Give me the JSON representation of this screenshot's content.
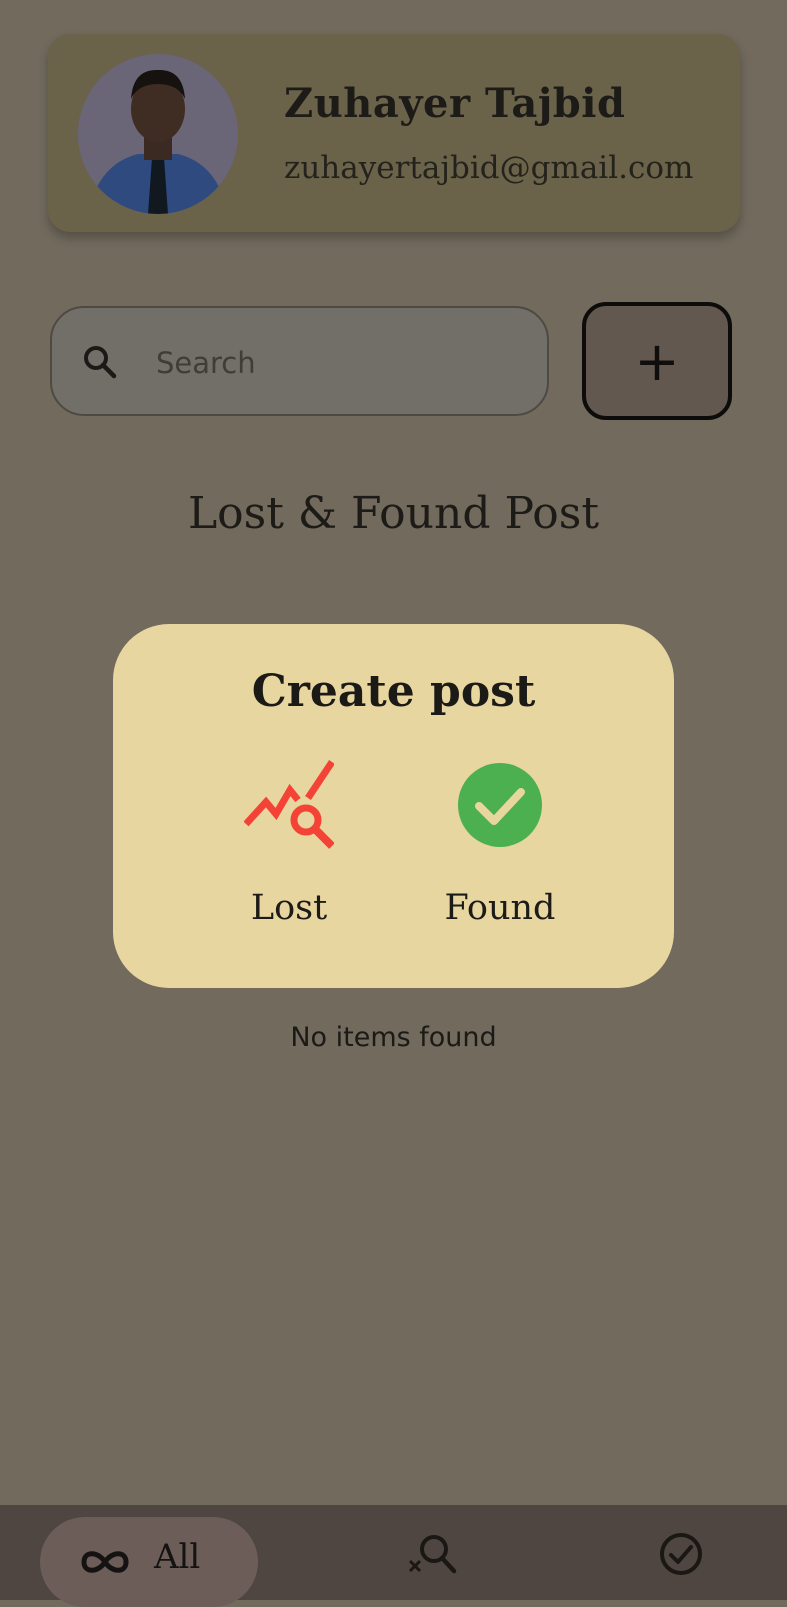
{
  "profile": {
    "name": "Zuhayer Tajbid",
    "email": "zuhayertajbid@gmail.com",
    "avatar_icon": "avatar-photo"
  },
  "search": {
    "placeholder": "Search",
    "value": "",
    "icon": "search-icon"
  },
  "add_button": {
    "label": "+",
    "icon": "plus-icon"
  },
  "section_title": "Lost & Found Post",
  "dialog": {
    "title": "Create post",
    "options": [
      {
        "label": "Lost",
        "icon": "lost-search-chart-icon",
        "color": "#f44336"
      },
      {
        "label": "Found",
        "icon": "check-circle-icon",
        "color": "#4caf50"
      }
    ]
  },
  "empty_state": "No items found",
  "bottom_nav": {
    "items": [
      {
        "label": "All",
        "icon": "infinity-icon",
        "active": true
      },
      {
        "label": "",
        "icon": "lost-search-icon",
        "active": false
      },
      {
        "label": "",
        "icon": "check-circle-outline-icon",
        "active": false
      }
    ]
  },
  "colors": {
    "background_overlay": "#716a5d",
    "dialog_bg": "#e8d6a0",
    "lost_red": "#f44336",
    "found_green": "#4caf50"
  }
}
